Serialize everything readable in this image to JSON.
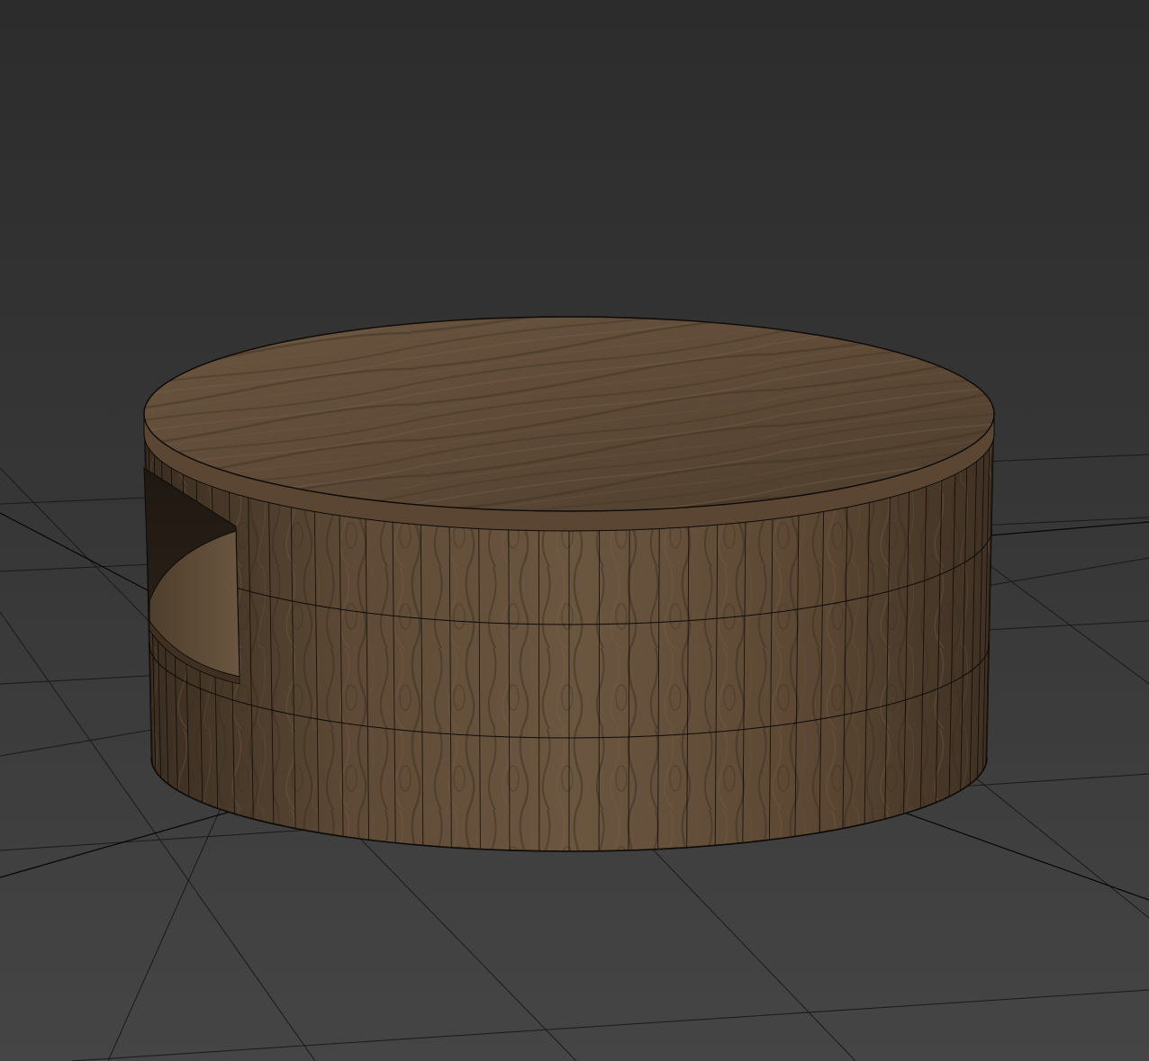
{
  "viewport": {
    "shading_mode": "realistic-with-edged-faces",
    "background_color": "#3b3b3b",
    "grid_visible": true,
    "grid_color": "#1a1a1a",
    "grid_axis_color": "#050505"
  },
  "scene": {
    "object": "round-wooden-coffee-table",
    "material": "dark-oak-wood",
    "wood_color": "#5a4632",
    "wood_highlight_color": "#6e5a44",
    "wood_shadow_color": "#3f3022",
    "wireframe_color": "#0d0a07",
    "side_segments_visible": 44,
    "side_height_divisions": 3
  }
}
